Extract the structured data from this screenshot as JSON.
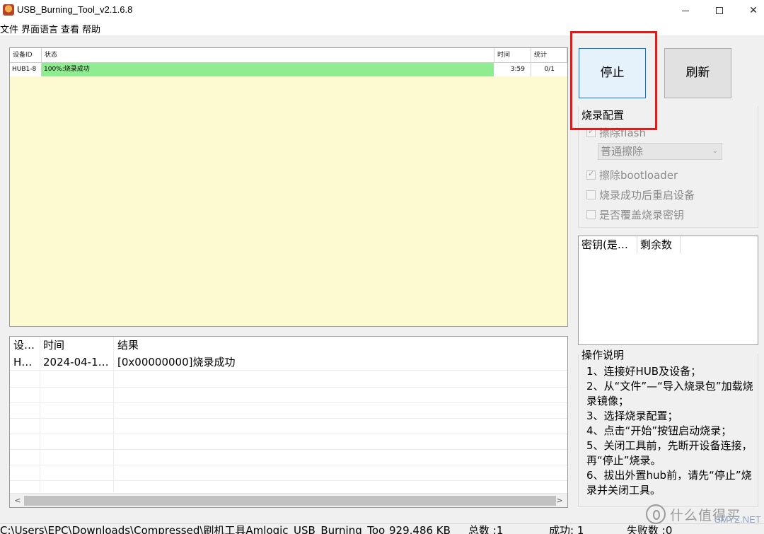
{
  "window": {
    "title": "USB_Burning_Tool_v2.1.6.8",
    "minimize_icon": "minimize-icon",
    "maximize_icon": "maximize-icon",
    "close_glyph": "✕"
  },
  "menu": [
    "文件",
    "界面语言",
    "查看",
    "帮助"
  ],
  "device_table": {
    "headers": [
      "设备ID",
      "状态",
      "时间",
      "统计"
    ],
    "rows": [
      {
        "id": "HUB1-8",
        "status": "100%:烧录成功",
        "time": "3:59",
        "stat": "0/1"
      }
    ],
    "status_color": "#90ec90",
    "background": "#fdfad2"
  },
  "log_table": {
    "headers": [
      "设…",
      "时间",
      "结果"
    ],
    "rows": [
      {
        "device": "H…",
        "time": "2024-04-1…",
        "result": "[0x00000000]烧录成功"
      }
    ],
    "scroll_left": "<",
    "scroll_right": ">"
  },
  "buttons": {
    "stop": "停止",
    "refresh": "刷新"
  },
  "burn_config": {
    "title": "烧录配置",
    "erase_flash": {
      "label": "擦除flash",
      "checked": true
    },
    "erase_mode": {
      "value": "普通擦除"
    },
    "erase_bootloader": {
      "label": "擦除bootloader",
      "checked": true
    },
    "reboot_after": {
      "label": "烧录成功后重启设备",
      "checked": false
    },
    "overwrite_key": {
      "label": "是否覆盖烧录密钥",
      "checked": false
    }
  },
  "key_table": {
    "headers": [
      "密钥(是…",
      "剩余数"
    ]
  },
  "help": {
    "title": "操作说明",
    "text": "1、连接好HUB及设备；\n2、从“文件”—“导入烧录包”加载烧录镜像；\n3、选择烧录配置；\n4、点击“开始”按钮启动烧录；\n5、关闭工具前，先断开设备连接，再“停止”烧录。\n6、拔出外置hub前，请先“停止”烧录并关闭工具。"
  },
  "statusbar": {
    "path": "C:\\Users\\EPC\\Downloads\\Compressed\\刷机工具Amlogic_USB_Burning_Too",
    "size": "929,486 KB",
    "total": "总数 :1",
    "success": "成功: 1",
    "failed": "失败数 :0"
  },
  "watermark": {
    "text": "什么值得买",
    "sub": "SMYZ.NET"
  },
  "highlight_color": "#e81818"
}
